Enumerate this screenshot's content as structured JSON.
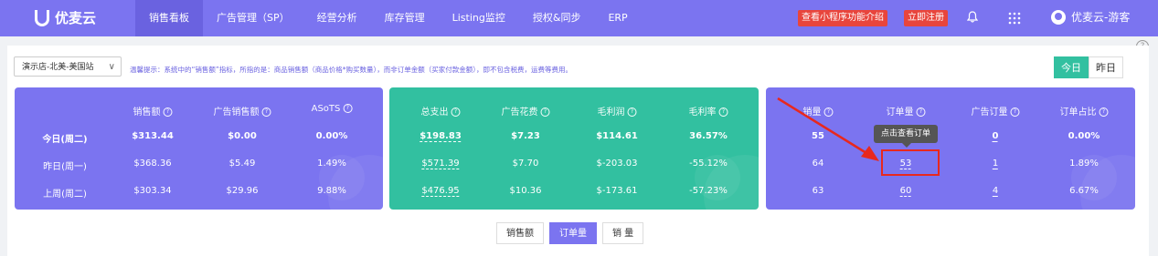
{
  "app": {
    "name": "优麦云"
  },
  "nav": {
    "items": [
      "销售看板",
      "广告管理（SP）",
      "经营分析",
      "库存管理",
      "Listing监控",
      "授权&同步",
      "ERP"
    ]
  },
  "header": {
    "promo_label": "查看小程序功能介绍",
    "register_label": "立即注册",
    "user_name": "优麦云-游客"
  },
  "help_glyph": "?",
  "filter": {
    "store": "演示店-北美-美国站",
    "tip": "温馨提示：系统中的“销售额”指标，所指的是：商品销售额（商品价格*购买数量），而非订单金额（买家付款金额），即不包含税费，运费等费用。"
  },
  "day_toggle": {
    "today": "今日",
    "yesterday": "昨日"
  },
  "row_labels": [
    "今日(周二)",
    "昨日(周一)",
    "上周(周二)"
  ],
  "panels": [
    {
      "headers": [
        "销售额",
        "广告销售额",
        "ASoTS"
      ],
      "rows": [
        [
          "$313.44",
          "$0.00",
          "0.00%"
        ],
        [
          "$368.36",
          "$5.49",
          "1.49%"
        ],
        [
          "$303.34",
          "$29.96",
          "9.88%"
        ]
      ]
    },
    {
      "headers": [
        "总支出",
        "广告花费",
        "毛利润",
        "毛利率"
      ],
      "rows": [
        [
          "$198.83",
          "$7.23",
          "$114.61",
          "36.57%"
        ],
        [
          "$571.39",
          "$7.70",
          "$-203.03",
          "-55.12%"
        ],
        [
          "$476.95",
          "$10.36",
          "$-173.61",
          "-57.23%"
        ]
      ]
    },
    {
      "headers": [
        "销量",
        "订单量",
        "广告订量",
        "订单占比"
      ],
      "rows": [
        [
          "55",
          "",
          "0",
          "0.00%"
        ],
        [
          "64",
          "53",
          "1",
          "1.89%"
        ],
        [
          "63",
          "60",
          "4",
          "6.67%"
        ]
      ]
    }
  ],
  "tooltip": "点击查看订单",
  "colors": {
    "purple": "#7b74f0",
    "green": "#32c0a0",
    "red": "#e8453c",
    "highlight": "#e8281e"
  },
  "bottom_tabs": [
    "销售额",
    "订单量",
    "销 量"
  ],
  "active_tab": "订单量"
}
